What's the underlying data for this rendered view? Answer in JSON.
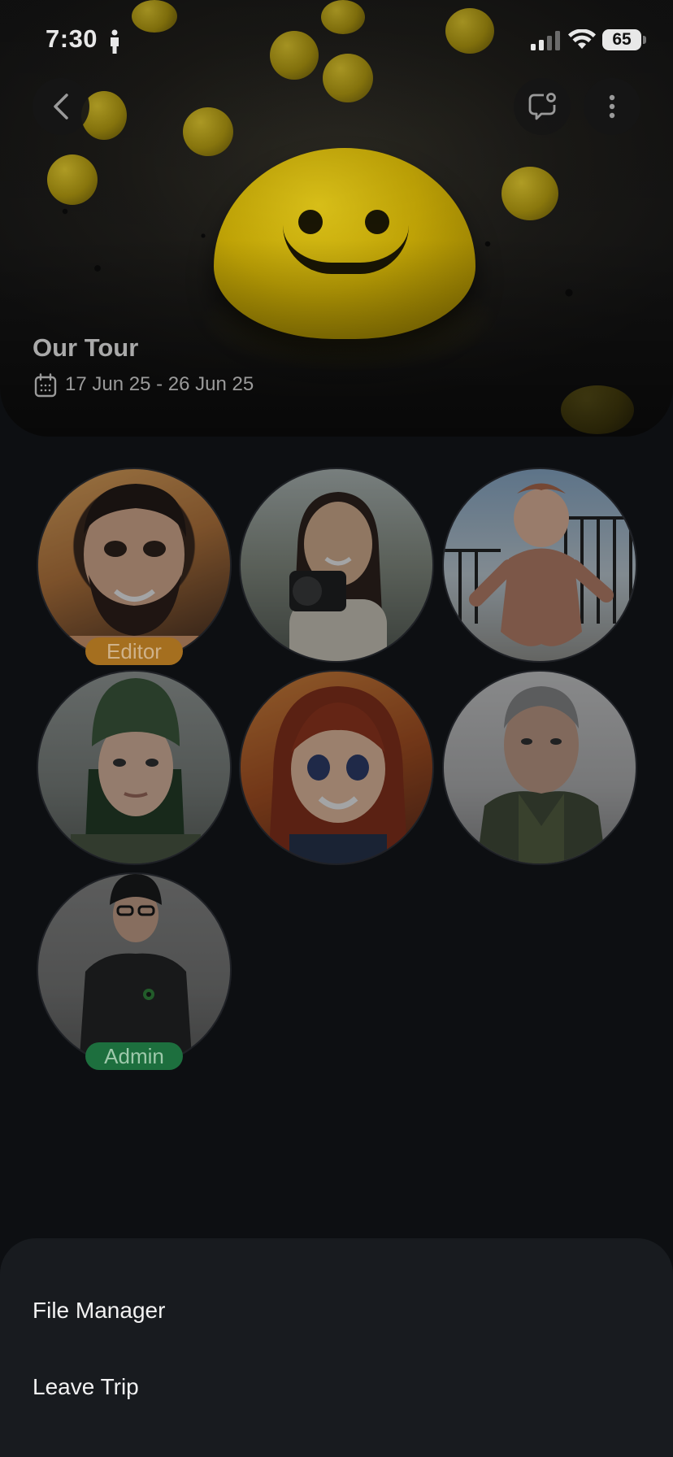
{
  "status_bar": {
    "time": "7:30",
    "battery": "65",
    "icons": [
      "person-icon",
      "signal-icon",
      "wifi-icon",
      "battery-icon"
    ]
  },
  "header": {
    "back_icon": "chevron-left-icon",
    "chat_icon": "chat-bubble-icon",
    "more_icon": "more-vertical-icon",
    "title": "Our Tour",
    "dates": "17 Jun 25 - 26 Jun 25",
    "date_icon": "calendar-icon"
  },
  "members": [
    {
      "name": "member-1",
      "role": "Editor",
      "bg": [
        "#e8a45a",
        "#5a3524"
      ]
    },
    {
      "name": "member-2",
      "role": "",
      "bg": [
        "#9fa8a0",
        "#4a4f45"
      ]
    },
    {
      "name": "member-3",
      "role": "",
      "bg": [
        "#8fb2d2",
        "#b8735a"
      ]
    },
    {
      "name": "member-4",
      "role": "",
      "bg": [
        "#8a8f8a",
        "#3a4a38"
      ]
    },
    {
      "name": "member-5",
      "role": "",
      "bg": [
        "#d8782a",
        "#6a2a14"
      ]
    },
    {
      "name": "member-6",
      "role": "",
      "bg": [
        "#c8c8c8",
        "#3f4a34"
      ]
    },
    {
      "name": "member-7",
      "role": "Admin",
      "bg": [
        "#8a8a8a",
        "#2a2a2a"
      ]
    }
  ],
  "sheet": {
    "items": [
      "File Manager",
      "Leave Trip"
    ]
  },
  "colors": {
    "background": "#0d0f12",
    "sheet": "#181b1f",
    "editor_badge": "#a56f1f",
    "admin_badge": "#1d6f3e"
  }
}
